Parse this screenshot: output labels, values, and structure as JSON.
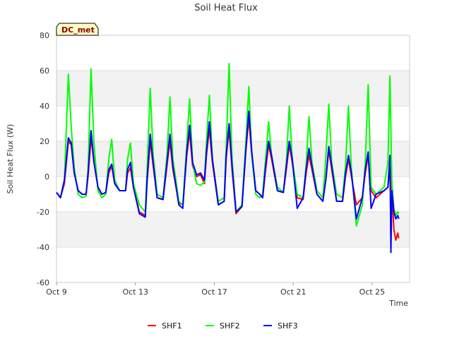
{
  "chart_data": {
    "type": "line",
    "title": "Soil Heat Flux",
    "xlabel": "Time",
    "ylabel": "Soil Heat Flux (W)",
    "badge": "DC_met",
    "ylim": [
      -60,
      80
    ],
    "yticks": [
      -60,
      -40,
      -20,
      0,
      20,
      40,
      60,
      80
    ],
    "xlim": [
      0,
      17.9
    ],
    "xticks": [
      {
        "value": 0,
        "label": "Oct 9"
      },
      {
        "value": 4,
        "label": "Oct 13"
      },
      {
        "value": 8,
        "label": "Oct 17"
      },
      {
        "value": 12,
        "label": "Oct 21"
      },
      {
        "value": 16,
        "label": "Oct 25"
      }
    ],
    "x_units": "days after Oct 9",
    "grid": true,
    "shaded_bands": true,
    "legend_position": "bottom-center",
    "series": [
      {
        "name": "SHF1",
        "color": "#ff0000",
        "points": [
          [
            0.0,
            -9
          ],
          [
            0.2,
            -12
          ],
          [
            0.4,
            -4
          ],
          [
            0.6,
            20
          ],
          [
            0.75,
            18
          ],
          [
            0.9,
            2
          ],
          [
            1.1,
            -8
          ],
          [
            1.3,
            -10
          ],
          [
            1.5,
            -10
          ],
          [
            1.6,
            0
          ],
          [
            1.75,
            22
          ],
          [
            1.9,
            8
          ],
          [
            2.1,
            -6
          ],
          [
            2.3,
            -10
          ],
          [
            2.5,
            -9
          ],
          [
            2.65,
            2
          ],
          [
            2.8,
            6
          ],
          [
            2.95,
            -4
          ],
          [
            3.2,
            -8
          ],
          [
            3.5,
            -8
          ],
          [
            3.6,
            2
          ],
          [
            3.75,
            5
          ],
          [
            3.9,
            -6
          ],
          [
            4.2,
            -20
          ],
          [
            4.5,
            -22
          ],
          [
            4.6,
            -2
          ],
          [
            4.75,
            20
          ],
          [
            4.9,
            6
          ],
          [
            5.1,
            -12
          ],
          [
            5.4,
            -13
          ],
          [
            5.6,
            6
          ],
          [
            5.75,
            20
          ],
          [
            5.9,
            4
          ],
          [
            6.2,
            -15
          ],
          [
            6.4,
            -16
          ],
          [
            6.6,
            12
          ],
          [
            6.75,
            25
          ],
          [
            6.9,
            6
          ],
          [
            7.1,
            0
          ],
          [
            7.3,
            1
          ],
          [
            7.5,
            -4
          ],
          [
            7.6,
            12
          ],
          [
            7.75,
            27
          ],
          [
            7.9,
            8
          ],
          [
            8.2,
            -16
          ],
          [
            8.5,
            -14
          ],
          [
            8.6,
            10
          ],
          [
            8.75,
            27
          ],
          [
            8.9,
            4
          ],
          [
            9.1,
            -21
          ],
          [
            9.4,
            -17
          ],
          [
            9.6,
            15
          ],
          [
            9.75,
            33
          ],
          [
            9.9,
            12
          ],
          [
            10.1,
            -8
          ],
          [
            10.3,
            -10
          ],
          [
            10.45,
            -12
          ],
          [
            10.6,
            4
          ],
          [
            10.75,
            18
          ],
          [
            10.9,
            10
          ],
          [
            11.2,
            -8
          ],
          [
            11.5,
            -9
          ],
          [
            11.65,
            4
          ],
          [
            11.8,
            18
          ],
          [
            11.95,
            8
          ],
          [
            12.2,
            -12
          ],
          [
            12.5,
            -13
          ],
          [
            12.65,
            2
          ],
          [
            12.8,
            12
          ],
          [
            12.95,
            4
          ],
          [
            13.2,
            -10
          ],
          [
            13.5,
            -14
          ],
          [
            13.65,
            -2
          ],
          [
            13.8,
            15
          ],
          [
            13.95,
            4
          ],
          [
            14.2,
            -14
          ],
          [
            14.5,
            -14
          ],
          [
            14.65,
            0
          ],
          [
            14.8,
            10
          ],
          [
            14.95,
            0
          ],
          [
            15.2,
            -16
          ],
          [
            15.5,
            -12
          ],
          [
            15.65,
            2
          ],
          [
            15.8,
            12
          ],
          [
            15.95,
            -8
          ],
          [
            16.2,
            -12
          ],
          [
            16.4,
            -10
          ],
          [
            16.6,
            -8
          ],
          [
            16.8,
            -6
          ],
          [
            16.9,
            6
          ],
          [
            17.0,
            -8
          ],
          [
            17.1,
            -30
          ],
          [
            17.2,
            -36
          ],
          [
            17.3,
            -32
          ],
          [
            17.35,
            -35
          ]
        ]
      },
      {
        "name": "SHF2",
        "color": "#00ff00",
        "points": [
          [
            0.0,
            -9
          ],
          [
            0.2,
            -12
          ],
          [
            0.4,
            -2
          ],
          [
            0.6,
            58
          ],
          [
            0.75,
            28
          ],
          [
            0.9,
            5
          ],
          [
            1.1,
            -10
          ],
          [
            1.3,
            -12
          ],
          [
            1.5,
            -11
          ],
          [
            1.6,
            4
          ],
          [
            1.75,
            61
          ],
          [
            1.9,
            18
          ],
          [
            2.1,
            -8
          ],
          [
            2.3,
            -12
          ],
          [
            2.5,
            -10
          ],
          [
            2.65,
            10
          ],
          [
            2.8,
            21
          ],
          [
            2.95,
            -2
          ],
          [
            3.2,
            -8
          ],
          [
            3.5,
            -8
          ],
          [
            3.6,
            10
          ],
          [
            3.75,
            19
          ],
          [
            3.9,
            -4
          ],
          [
            4.2,
            -16
          ],
          [
            4.5,
            -20
          ],
          [
            4.6,
            6
          ],
          [
            4.75,
            50
          ],
          [
            4.9,
            12
          ],
          [
            5.1,
            -10
          ],
          [
            5.4,
            -12
          ],
          [
            5.6,
            12
          ],
          [
            5.75,
            45
          ],
          [
            5.9,
            10
          ],
          [
            6.2,
            -14
          ],
          [
            6.4,
            -16
          ],
          [
            6.6,
            18
          ],
          [
            6.75,
            44
          ],
          [
            6.9,
            8
          ],
          [
            7.1,
            -4
          ],
          [
            7.3,
            -5
          ],
          [
            7.5,
            -3
          ],
          [
            7.6,
            20
          ],
          [
            7.75,
            46
          ],
          [
            7.9,
            10
          ],
          [
            8.2,
            -14
          ],
          [
            8.5,
            -12
          ],
          [
            8.6,
            16
          ],
          [
            8.75,
            64
          ],
          [
            8.9,
            10
          ],
          [
            9.1,
            -20
          ],
          [
            9.4,
            -16
          ],
          [
            9.6,
            20
          ],
          [
            9.75,
            51
          ],
          [
            9.9,
            12
          ],
          [
            10.1,
            -10
          ],
          [
            10.3,
            -12
          ],
          [
            10.45,
            -10
          ],
          [
            10.6,
            10
          ],
          [
            10.75,
            31
          ],
          [
            10.9,
            12
          ],
          [
            11.2,
            -6
          ],
          [
            11.5,
            -9
          ],
          [
            11.65,
            8
          ],
          [
            11.8,
            40
          ],
          [
            11.95,
            10
          ],
          [
            12.2,
            -10
          ],
          [
            12.5,
            -12
          ],
          [
            12.65,
            6
          ],
          [
            12.8,
            34
          ],
          [
            12.95,
            8
          ],
          [
            13.2,
            -8
          ],
          [
            13.5,
            -12
          ],
          [
            13.65,
            10
          ],
          [
            13.8,
            41
          ],
          [
            13.95,
            8
          ],
          [
            14.2,
            -10
          ],
          [
            14.5,
            -12
          ],
          [
            14.65,
            6
          ],
          [
            14.8,
            40
          ],
          [
            14.95,
            4
          ],
          [
            15.2,
            -28
          ],
          [
            15.5,
            -16
          ],
          [
            15.65,
            8
          ],
          [
            15.8,
            52
          ],
          [
            15.95,
            -6
          ],
          [
            16.2,
            -10
          ],
          [
            16.4,
            -8
          ],
          [
            16.6,
            -6
          ],
          [
            16.8,
            8
          ],
          [
            16.9,
            57
          ],
          [
            17.0,
            -4
          ],
          [
            17.1,
            -18
          ],
          [
            17.2,
            -22
          ],
          [
            17.3,
            -20
          ],
          [
            17.35,
            -21
          ]
        ]
      },
      {
        "name": "SHF3",
        "color": "#0000ff",
        "points": [
          [
            0.0,
            -9
          ],
          [
            0.2,
            -12
          ],
          [
            0.4,
            -2
          ],
          [
            0.6,
            22
          ],
          [
            0.75,
            19
          ],
          [
            0.9,
            2
          ],
          [
            1.1,
            -8
          ],
          [
            1.3,
            -10
          ],
          [
            1.5,
            -10
          ],
          [
            1.6,
            2
          ],
          [
            1.75,
            26
          ],
          [
            1.9,
            8
          ],
          [
            2.1,
            -6
          ],
          [
            2.3,
            -10
          ],
          [
            2.5,
            -9
          ],
          [
            2.65,
            4
          ],
          [
            2.8,
            7
          ],
          [
            2.95,
            -4
          ],
          [
            3.2,
            -8
          ],
          [
            3.5,
            -8
          ],
          [
            3.6,
            4
          ],
          [
            3.75,
            8
          ],
          [
            3.9,
            -6
          ],
          [
            4.2,
            -21
          ],
          [
            4.5,
            -23
          ],
          [
            4.6,
            0
          ],
          [
            4.75,
            24
          ],
          [
            4.9,
            8
          ],
          [
            5.1,
            -12
          ],
          [
            5.4,
            -13
          ],
          [
            5.6,
            8
          ],
          [
            5.75,
            24
          ],
          [
            5.9,
            6
          ],
          [
            6.2,
            -16
          ],
          [
            6.4,
            -18
          ],
          [
            6.6,
            14
          ],
          [
            6.75,
            29
          ],
          [
            6.9,
            8
          ],
          [
            7.1,
            1
          ],
          [
            7.3,
            2
          ],
          [
            7.5,
            -2
          ],
          [
            7.6,
            14
          ],
          [
            7.75,
            31
          ],
          [
            7.9,
            10
          ],
          [
            8.2,
            -16
          ],
          [
            8.5,
            -14
          ],
          [
            8.6,
            12
          ],
          [
            8.75,
            30
          ],
          [
            8.9,
            6
          ],
          [
            9.1,
            -20
          ],
          [
            9.4,
            -17
          ],
          [
            9.6,
            16
          ],
          [
            9.75,
            37
          ],
          [
            9.9,
            14
          ],
          [
            10.1,
            -8
          ],
          [
            10.3,
            -10
          ],
          [
            10.45,
            -12
          ],
          [
            10.6,
            6
          ],
          [
            10.75,
            20
          ],
          [
            10.9,
            12
          ],
          [
            11.2,
            -8
          ],
          [
            11.5,
            -9
          ],
          [
            11.65,
            6
          ],
          [
            11.8,
            20
          ],
          [
            11.95,
            10
          ],
          [
            12.2,
            -18
          ],
          [
            12.5,
            -12
          ],
          [
            12.65,
            4
          ],
          [
            12.8,
            16
          ],
          [
            12.95,
            6
          ],
          [
            13.2,
            -10
          ],
          [
            13.5,
            -14
          ],
          [
            13.65,
            -2
          ],
          [
            13.8,
            17
          ],
          [
            13.95,
            6
          ],
          [
            14.2,
            -14
          ],
          [
            14.5,
            -14
          ],
          [
            14.65,
            2
          ],
          [
            14.8,
            12
          ],
          [
            14.95,
            2
          ],
          [
            15.2,
            -24
          ],
          [
            15.5,
            -12
          ],
          [
            15.65,
            4
          ],
          [
            15.8,
            14
          ],
          [
            15.95,
            -18
          ],
          [
            16.2,
            -10
          ],
          [
            16.4,
            -9
          ],
          [
            16.6,
            -8
          ],
          [
            16.8,
            -6
          ],
          [
            16.9,
            12
          ],
          [
            16.95,
            -43
          ],
          [
            17.0,
            -8
          ],
          [
            17.1,
            -20
          ],
          [
            17.2,
            -24
          ],
          [
            17.3,
            -22
          ],
          [
            17.35,
            -24
          ]
        ]
      }
    ]
  }
}
